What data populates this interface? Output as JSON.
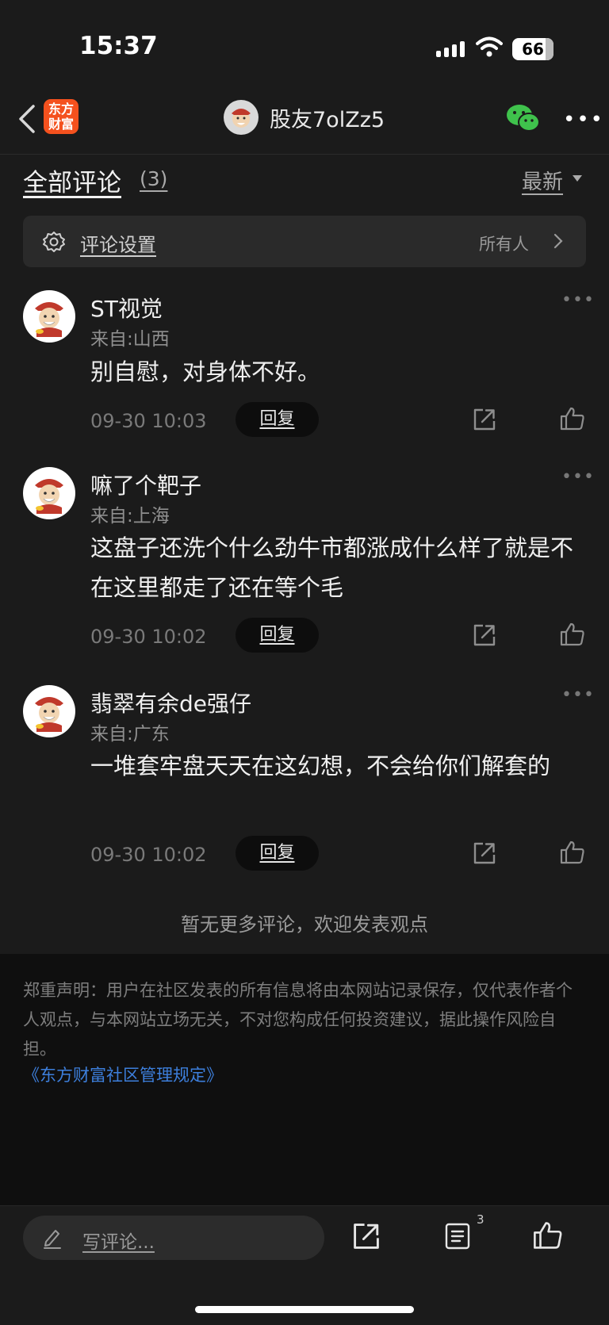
{
  "status_bar": {
    "time": "15:37",
    "battery": "66"
  },
  "nav": {
    "logo_line1": "东方",
    "logo_line2": "财富",
    "title": "股友7olZz5"
  },
  "header": {
    "title": "全部评论",
    "count": "(3)",
    "sort": "最新"
  },
  "settings": {
    "label": "评论设置",
    "value": "所有人"
  },
  "comments": [
    {
      "name": "ST视觉",
      "location": "来自:山西",
      "text": "别自慰，对身体不好。",
      "time": "09-30 10:03",
      "reply": "回复"
    },
    {
      "name": "嘛了个靶子",
      "location": "来自:上海",
      "text": "这盘子还洗个什么劲牛市都涨成什么样了就是不在这里都走了还在等个毛",
      "time": "09-30 10:02",
      "reply": "回复"
    },
    {
      "name": "翡翠有余de强仔",
      "location": "来自:广东",
      "text": "一堆套牢盘天天在这幻想，不会给你们解套的",
      "time": "09-30 10:02",
      "reply": "回复"
    }
  ],
  "no_more": "暂无更多评论，欢迎发表观点",
  "disclaimer": {
    "text": "郑重声明：用户在社区发表的所有信息将由本网站记录保存，仅代表作者个人观点，与本网站立场无关，不对您构成任何投资建议，据此操作风险自担。",
    "link": "《东方财富社区管理规定》"
  },
  "bottom_bar": {
    "placeholder": "写评论...",
    "comment_count": "3"
  },
  "colors": {
    "background": "#1b1b1b",
    "logo": "#f4511e",
    "link": "#3d7fdc",
    "wechat": "#3fc24c"
  }
}
